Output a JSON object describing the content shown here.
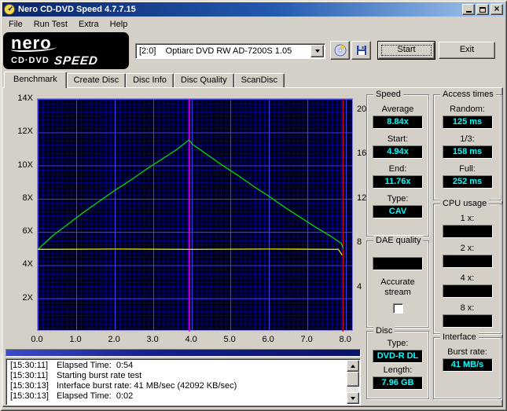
{
  "window": {
    "title": "Nero CD-DVD Speed 4.7.7.15"
  },
  "menu": {
    "items": [
      "File",
      "Run Test",
      "Extra",
      "Help"
    ]
  },
  "toolbar": {
    "logo": {
      "line1": "nero",
      "line2": "CD·DVD",
      "line3": "SPEED"
    },
    "drive_combo": "[2:0]    Optiarc DVD RW AD-7200S 1.05",
    "start_label": "Start",
    "exit_label": "Exit"
  },
  "tabs": [
    "Benchmark",
    "Create Disc",
    "Disc Info",
    "Disc Quality",
    "ScanDisc"
  ],
  "active_tab": "Benchmark",
  "chart_data": {
    "type": "line",
    "x_axis": {
      "labels": [
        "0.0",
        "1.0",
        "2.0",
        "3.0",
        "4.0",
        "5.0",
        "6.0",
        "7.0",
        "8.0"
      ],
      "max": 8.2,
      "unit": "GB"
    },
    "y_left": {
      "labels": [
        "14X",
        "12X",
        "10X",
        "8X",
        "6X",
        "4X",
        "2X"
      ],
      "max": 14
    },
    "y_right": {
      "labels": [
        "20",
        "16",
        "12",
        "8",
        "4"
      ],
      "max": 21
    },
    "series": [
      {
        "name": "read-speed",
        "color": "#00dd00",
        "points": [
          [
            0,
            4.94
          ],
          [
            0.4,
            5.8
          ],
          [
            0.8,
            6.5
          ],
          [
            1.2,
            7.2
          ],
          [
            1.6,
            7.85
          ],
          [
            2.0,
            8.5
          ],
          [
            2.4,
            9.1
          ],
          [
            2.8,
            9.75
          ],
          [
            3.2,
            10.35
          ],
          [
            3.6,
            10.95
          ],
          [
            3.93,
            11.55
          ],
          [
            4.0,
            11.3
          ],
          [
            4.4,
            10.65
          ],
          [
            4.8,
            10.0
          ],
          [
            5.2,
            9.4
          ],
          [
            5.6,
            8.75
          ],
          [
            6.0,
            8.15
          ],
          [
            6.4,
            7.5
          ],
          [
            6.8,
            6.9
          ],
          [
            7.2,
            6.3
          ],
          [
            7.6,
            5.75
          ],
          [
            7.88,
            5.3
          ],
          [
            7.93,
            5.0
          ]
        ]
      },
      {
        "name": "rotation-speed",
        "color": "#e8e800",
        "points": [
          [
            0,
            4.95
          ],
          [
            2.0,
            4.97
          ],
          [
            4.0,
            4.95
          ],
          [
            6.0,
            4.97
          ],
          [
            7.8,
            4.95
          ],
          [
            7.9,
            4.6
          ]
        ]
      }
    ],
    "markers": [
      {
        "name": "layer-break",
        "color": "#d400d4",
        "x": 3.93
      },
      {
        "name": "test-end",
        "color": "#cc0000",
        "x": 7.92
      }
    ]
  },
  "panels": {
    "speed": {
      "title": "Speed",
      "fields": [
        {
          "label": "Average",
          "value": "8.84x"
        },
        {
          "label": "Start:",
          "value": "4.94x"
        },
        {
          "label": "End:",
          "value": "11.76x"
        },
        {
          "label": "Type:",
          "value": "CAV"
        }
      ]
    },
    "access": {
      "title": "Access times",
      "fields": [
        {
          "label": "Random:",
          "value": "125 ms"
        },
        {
          "label": "1/3:",
          "value": "158 ms"
        },
        {
          "label": "Full:",
          "value": "252 ms"
        }
      ]
    },
    "cpu": {
      "title": "CPU usage",
      "fields": [
        {
          "label": "1 x:",
          "value": ""
        },
        {
          "label": "2 x:",
          "value": ""
        },
        {
          "label": "4 x:",
          "value": ""
        },
        {
          "label": "8 x:",
          "value": ""
        }
      ]
    },
    "dae": {
      "title": "DAE quality",
      "value": "",
      "checkbox_label": "Accurate stream"
    },
    "disc": {
      "title": "Disc",
      "fields": [
        {
          "label": "Type:",
          "value": "DVD-R DL"
        },
        {
          "label": "Length:",
          "value": "7.96 GB"
        }
      ]
    },
    "interface": {
      "title": "Interface",
      "fields": [
        {
          "label": "Burst rate:",
          "value": "41 MB/s"
        }
      ]
    }
  },
  "log": {
    "entries": [
      {
        "time": "[15:30:11]",
        "text": "Elapsed Time:  0:54"
      },
      {
        "time": "[15:30:11]",
        "text": "Starting burst rate test"
      },
      {
        "time": "[15:30:13]",
        "text": "Interface burst rate: 41 MB/sec (42092 KB/sec)"
      },
      {
        "time": "[15:30:13]",
        "text": "Elapsed Time:  0:02"
      }
    ]
  }
}
